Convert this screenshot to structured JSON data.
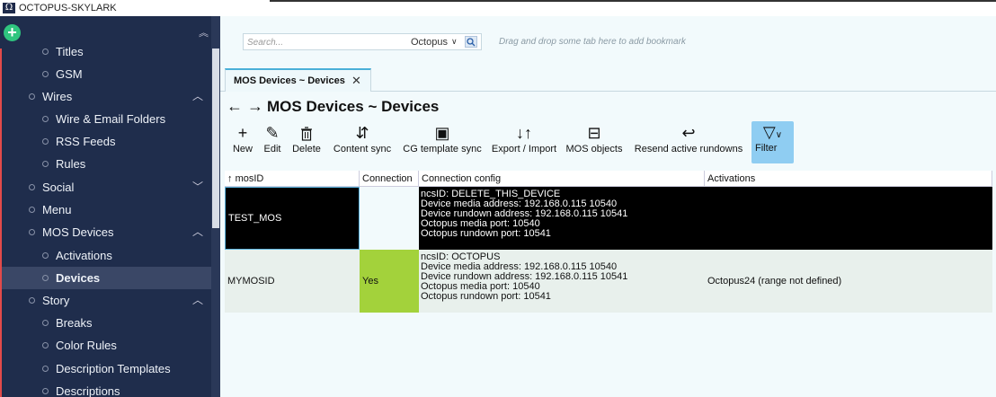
{
  "app": {
    "title": "OCTOPUS-SKYLARK",
    "logo_glyph": "Ω"
  },
  "sidebar": {
    "add_glyph": "+",
    "collapse_glyph": "︽",
    "items": [
      {
        "label": "Titles",
        "level": 2
      },
      {
        "label": "GSM",
        "level": 2
      },
      {
        "label": "Wires",
        "level": 1,
        "chevron": "︿"
      },
      {
        "label": "Wire & Email Folders",
        "level": 2
      },
      {
        "label": "RSS Feeds",
        "level": 2
      },
      {
        "label": "Rules",
        "level": 2
      },
      {
        "label": "Social",
        "level": 1,
        "chevron": "﹀"
      },
      {
        "label": "Menu",
        "level": 1
      },
      {
        "label": "MOS Devices",
        "level": 1,
        "chevron": "︿"
      },
      {
        "label": "Activations",
        "level": 2
      },
      {
        "label": "Devices",
        "level": 2,
        "selected": true
      },
      {
        "label": "Story",
        "level": 1,
        "chevron": "︿"
      },
      {
        "label": "Breaks",
        "level": 2
      },
      {
        "label": "Color Rules",
        "level": 2
      },
      {
        "label": "Description Templates",
        "level": 2
      },
      {
        "label": "Descriptions",
        "level": 2
      }
    ]
  },
  "search": {
    "placeholder": "Search...",
    "scope": "Octopus",
    "scope_chevron": "∨",
    "icon": "search-icon",
    "bookmark_hint": "Drag and drop some tab here to add bookmark"
  },
  "tab": {
    "label": "MOS Devices  ~ Devices",
    "close_glyph": "✕"
  },
  "page": {
    "back_glyph": "←",
    "forward_glyph": "→",
    "title": "MOS Devices  ~ Devices"
  },
  "toolbar": [
    {
      "label": "New",
      "glyph": "+",
      "name": "new-button"
    },
    {
      "label": "Edit",
      "glyph": "✎",
      "name": "edit-button"
    },
    {
      "label": "Delete",
      "glyph": "🗑",
      "name": "delete-button"
    },
    {
      "label": "Content sync",
      "glyph": "⇵",
      "name": "content-sync-button"
    },
    {
      "label": "CG template sync",
      "glyph": "▣",
      "name": "cg-template-sync-button"
    },
    {
      "label": "Export / Import",
      "glyph": "↓↑",
      "name": "export-import-button"
    },
    {
      "label": "MOS objects",
      "glyph": "⊟",
      "name": "mos-objects-button"
    },
    {
      "label": "Resend active rundowns",
      "glyph": "↩",
      "name": "resend-rundowns-button"
    },
    {
      "label": "Filter",
      "glyph": "▽",
      "name": "filter-button",
      "chevron": "∨"
    }
  ],
  "table": {
    "sort_glyph": "↑",
    "columns": [
      "mosID",
      "Connection",
      "Connection config",
      "Activations"
    ],
    "rows": [
      {
        "mosID": "TEST_MOS",
        "connection": "",
        "config": [
          "ncsID: DELETE_THIS_DEVICE",
          "Device media address: 192.168.0.115 10540",
          "Device rundown address: 192.168.0.115 10541",
          "Octopus media port: 10540",
          "Octopus rundown port: 10541"
        ],
        "activations": ""
      },
      {
        "mosID": "MYMOSID",
        "connection": "Yes",
        "config": [
          "ncsID: OCTOPUS",
          "Device media address: 192.168.0.115 10540",
          "Device rundown address: 192.168.0.115 10541",
          "Octopus media port: 10540",
          "Octopus rundown port: 10541"
        ],
        "activations": "Octopus24 (range not defined)"
      }
    ]
  },
  "colors": {
    "sidebar_bg": "#1f2d4c",
    "accent_green": "#2fc57f",
    "yes_green": "#a3d23b",
    "filter_blue": "#8fcdf2"
  }
}
